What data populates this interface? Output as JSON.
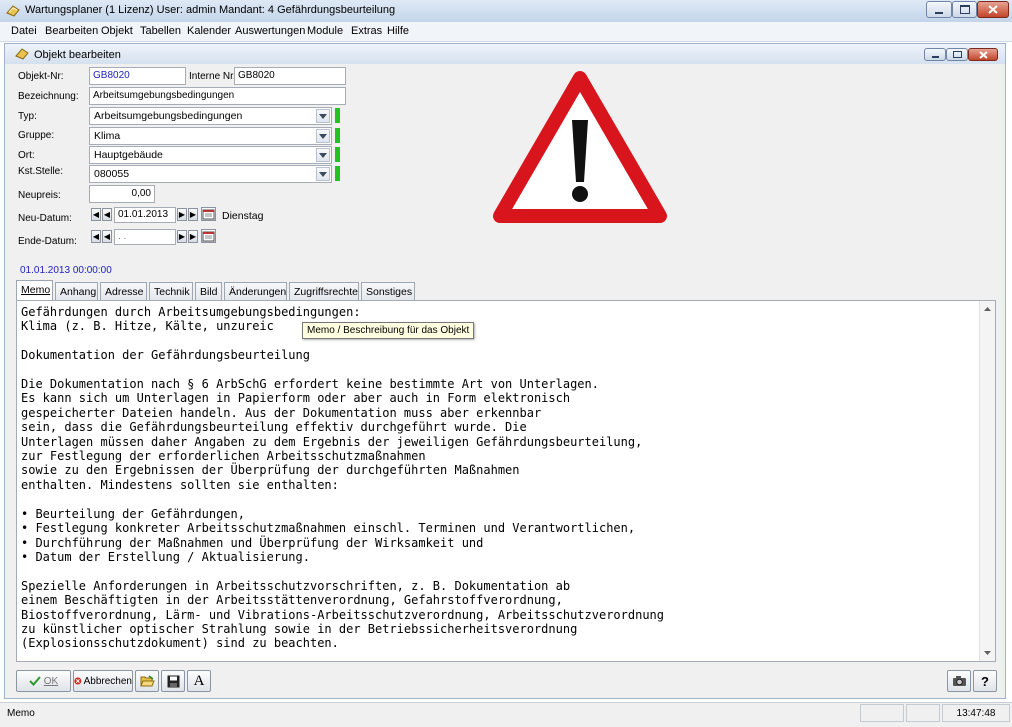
{
  "window": {
    "title": "Wartungsplaner  (1 Lizenz)    User: admin Mandant: 4 Gefährdungsbeurteilung"
  },
  "menu": [
    "Datei",
    "Bearbeiten",
    "Objekt",
    "Tabellen",
    "Kalender",
    "Auswertungen",
    "Module",
    "Extras",
    "Hilfe"
  ],
  "child_window": {
    "title": "Objekt bearbeiten"
  },
  "form": {
    "objekt_nr_label": "Objekt-Nr:",
    "objekt_nr_value": "GB8020",
    "interne_nr_label": "Interne Nr.:",
    "interne_nr_value": "GB8020",
    "bezeichnung_label": "Bezeichnung:",
    "bezeichnung_value": "Arbeitsumgebungsbedingungen",
    "typ_label": "Typ:",
    "typ_value": "Arbeitsumgebungsbedingungen",
    "gruppe_label": "Gruppe:",
    "gruppe_value": "Klima",
    "ort_label": "Ort:",
    "ort_value": "Hauptgebäude",
    "kst_label": "Kst.Stelle:",
    "kst_value": "080055",
    "neupreis_label": "Neupreis:",
    "neupreis_value": "0,00",
    "neu_datum_label": "Neu-Datum:",
    "neu_datum_value": "01.01.2013",
    "neu_datum_weekday": "Dienstag",
    "ende_datum_label": "Ende-Datum:",
    "ende_datum_value": " .  .",
    "timestamp": "01.01.2013 00:00:00"
  },
  "tabs": [
    "Memo",
    "Anhang",
    "Adresse",
    "Technik",
    "Bild",
    "Änderungen",
    "Zugriffsrechte",
    "Sonstiges"
  ],
  "memo": {
    "text": "Gefährdungen durch Arbeitsumgebungsbedingungen:\nKlima (z. B. Hitze, Kälte, unzureic\n\nDokumentation der Gefährdungsbeurteilung\n\nDie Dokumentation nach § 6 ArbSchG erfordert keine bestimmte Art von Unterlagen.\nEs kann sich um Unterlagen in Papierform oder aber auch in Form elektronisch\ngespeicherter Dateien handeln. Aus der Dokumentation muss aber erkennbar\nsein, dass die Gefährdungsbeurteilung effektiv durchgeführt wurde. Die\nUnterlagen müssen daher Angaben zu dem Ergebnis der jeweiligen Gefährdungsbeurteilung,\nzur Festlegung der erforderlichen Arbeitsschutzmaßnahmen\nsowie zu den Ergebnissen der Überprüfung der durchgeführten Maßnahmen\nenthalten. Mindestens sollten sie enthalten:\n\n• Beurteilung der Gefährdungen,\n• Festlegung konkreter Arbeitsschutzmaßnahmen einschl. Terminen und Verantwortlichen,\n• Durchführung der Maßnahmen und Überprüfung der Wirksamkeit und\n• Datum der Erstellung / Aktualisierung.\n\nSpezielle Anforderungen in Arbeitsschutzvorschriften, z. B. Dokumentation ab\neinem Beschäftigten in der Arbeitsstättenverordnung, Gefahrstoffverordnung,\nBiostoffverordnung, Lärm- und Vibrations-Arbeitsschutzverordnung, Arbeitsschutzverordnung\nzu künstlicher optischer Strahlung sowie in der Betriebssicherheitsverordnung\n(Explosionsschutzdokument) sind zu beachten."
  },
  "tooltip": "Memo / Beschreibung für das Objekt",
  "toolbar": {
    "ok_label": "OK",
    "cancel_label": "Abbrechen",
    "font_label": "A",
    "help_label": "?"
  },
  "status": {
    "left": "Memo",
    "time": "13:47:48"
  },
  "colors": {
    "warning_red": "#d8141c",
    "required_green": "#22c222",
    "link_blue": "#2020c0"
  },
  "icons": [
    "app-icon",
    "object-icon",
    "warning-sign-icon",
    "calendar-icon",
    "checkmark-icon",
    "cancel-icon",
    "folder-open-icon",
    "save-icon",
    "font-icon",
    "camera-icon",
    "help-icon"
  ]
}
